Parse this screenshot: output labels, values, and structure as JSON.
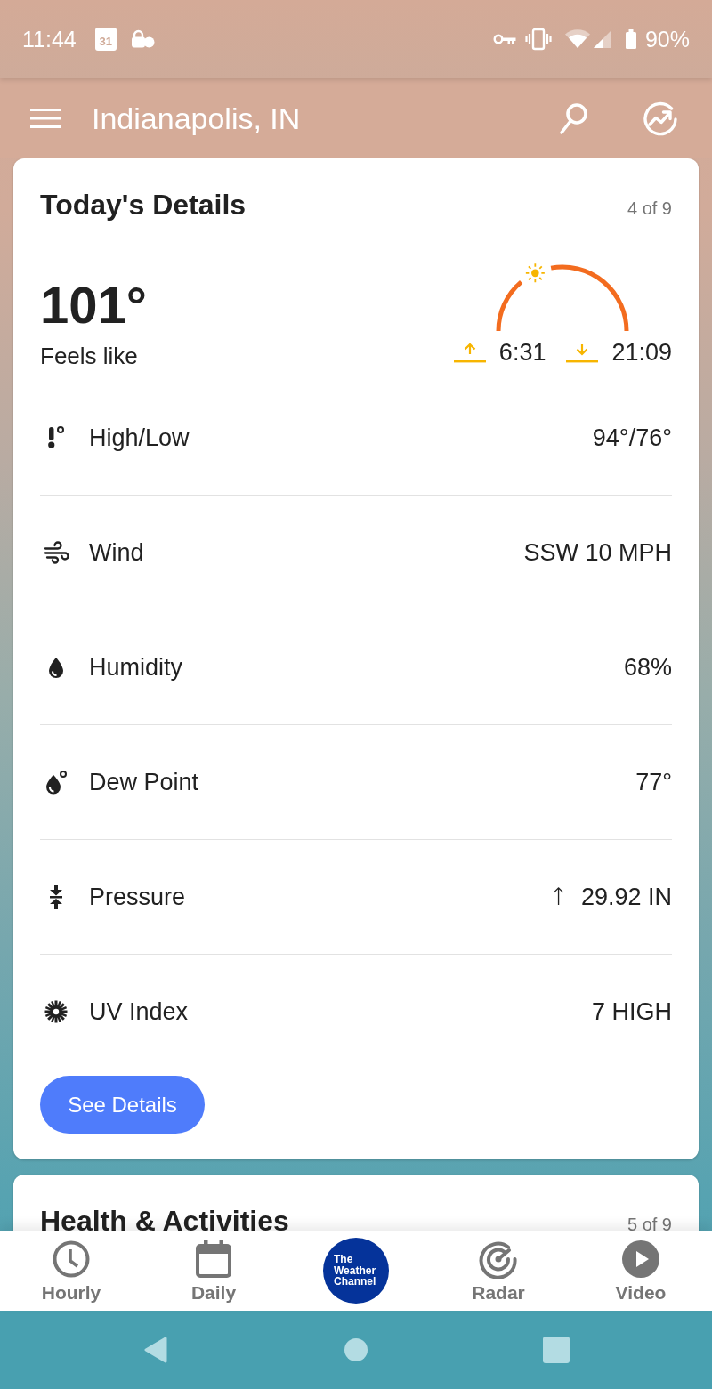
{
  "status_bar": {
    "time": "11:44",
    "calendar_day": "31",
    "battery": "90%"
  },
  "app_bar": {
    "title": "Indianapolis, IN"
  },
  "cards": [
    {
      "title": "Today's Details",
      "position": "4 of 9",
      "feels_like": {
        "temperature": "101°",
        "label": "Feels like"
      },
      "sun": {
        "level": 0.36,
        "sunrise": "6:31",
        "sunset": "21:09"
      },
      "details": [
        {
          "kind": "high_low",
          "label": "High/Low",
          "value": "94°/76°"
        },
        {
          "kind": "wind",
          "label": "Wind",
          "value": "SSW 10 MPH"
        },
        {
          "kind": "humidity",
          "label": "Humidity",
          "value": "68%"
        },
        {
          "kind": "dew_point",
          "label": "Dew Point",
          "value": "77°"
        },
        {
          "kind": "pressure",
          "label": "Pressure",
          "trend_arrow": "↑",
          "value": "29.92 IN"
        },
        {
          "kind": "uv_index",
          "label": "UV Index",
          "value": "7 HIGH"
        }
      ],
      "button": "See Details"
    },
    {
      "title": "Health & Activities",
      "position": "5 of 9"
    }
  ],
  "bottom_nav": [
    {
      "kind": "hourly",
      "label": "Hourly"
    },
    {
      "kind": "daily",
      "label": "Daily"
    },
    {
      "kind": "logo",
      "lines": [
        "The",
        "Weather",
        "Channel"
      ]
    },
    {
      "kind": "radar",
      "label": "Radar"
    },
    {
      "kind": "video",
      "label": "Video"
    }
  ]
}
